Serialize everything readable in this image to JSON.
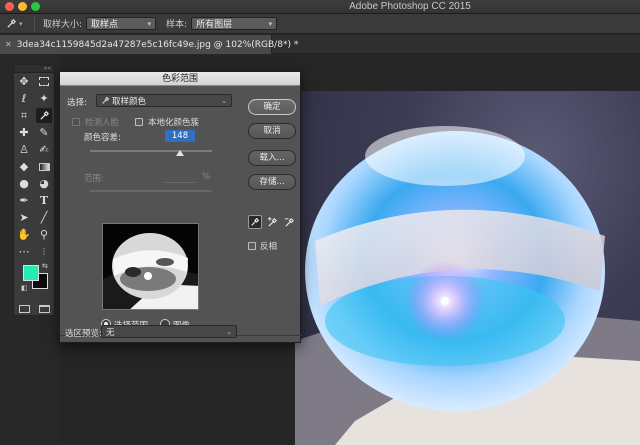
{
  "app": {
    "title": "Adobe Photoshop CC 2015"
  },
  "options_bar": {
    "tool_icon": "eyedropper-icon",
    "sample_size_label": "取样大小:",
    "sample_size_value": "取样点",
    "sample_label": "样本:",
    "sample_value": "所有图层"
  },
  "document": {
    "tab_title": "3dea34c1159845d2a47287e5c16fc49e.jpg @ 102%(RGB/8*) *",
    "close_icon": "close-icon"
  },
  "toolbar": {
    "collapse": "««",
    "tools": [
      [
        "move-icon",
        "marquee-icon"
      ],
      [
        "lasso-icon",
        "magic-wand-icon"
      ],
      [
        "crop-icon",
        "eyedropper-icon"
      ],
      [
        "healing-icon",
        "brush-icon"
      ],
      [
        "stamp-icon",
        "history-brush-icon"
      ],
      [
        "eraser-icon",
        "gradient-icon"
      ],
      [
        "blur-icon",
        "dodge-icon"
      ],
      [
        "pen-icon",
        "type-icon"
      ],
      [
        "path-select-icon",
        "line-icon"
      ],
      [
        "hand-icon",
        "zoom-icon"
      ],
      [
        "more-icon",
        "edit-toolbar-icon"
      ]
    ],
    "foreground_color": "#24ecb5",
    "background_color": "#0a0a0a"
  },
  "dialog": {
    "title": "色彩范围",
    "select_label": "选择:",
    "select_value": "取样颜色",
    "detect_faces_label": "检测人脸",
    "localized_label": "本地化颜色簇",
    "fuzziness_label": "颜色容差:",
    "fuzziness_value": "148",
    "range_label": "范围:",
    "range_unit": "%",
    "radio_selection": "选择范围",
    "radio_image": "图像",
    "preview_label": "选区预览:",
    "preview_value": "无",
    "buttons": {
      "ok": "确定",
      "cancel": "取消",
      "load": "载入...",
      "save": "存储..."
    },
    "invert_label": "反相"
  }
}
